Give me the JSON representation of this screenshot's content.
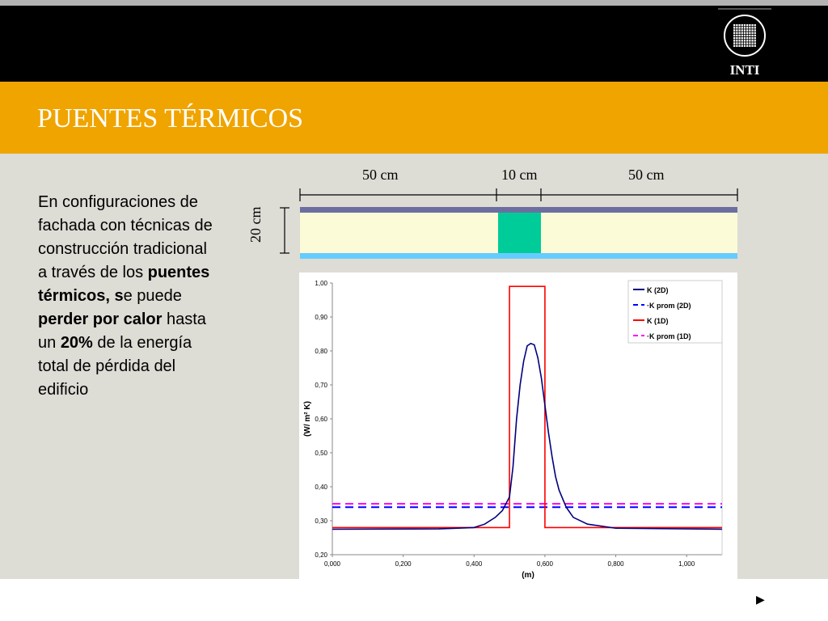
{
  "header": {
    "logo_text": "INTI",
    "title": "PUENTES TÉRMICOS"
  },
  "text": {
    "p1": "En configuraciones de fachada con técnicas de construcción tradicional a través de los ",
    "b1": "puentes térmicos, s",
    "p2": "e puede ",
    "b2": "perder por calor",
    "p3": " hasta un ",
    "b3": "20%",
    "p4": " de la energía total de pérdida del edificio"
  },
  "diagram": {
    "dim_left": "50 cm",
    "dim_mid": "10 cm",
    "dim_right": "50 cm",
    "dim_height": "20 cm",
    "colors": {
      "outer": "#6b6fa0",
      "insulation": "#fbfbd8",
      "bridge": "#00cc99",
      "inner": "#66ccff"
    }
  },
  "chart_data": {
    "type": "line",
    "xlabel": "(m)",
    "ylabel": "(W/ m² K)",
    "xlim": [
      0,
      1.1
    ],
    "ylim": [
      0.2,
      1.0
    ],
    "xticks": [
      "0,000",
      "0,200",
      "0,400",
      "0,600",
      "0,800",
      "1,000"
    ],
    "xtick_values": [
      0,
      0.2,
      0.4,
      0.6,
      0.8,
      1.0
    ],
    "yticks": [
      "0,20",
      "0,30",
      "0,40",
      "0,50",
      "0,60",
      "0,70",
      "0,80",
      "0,90",
      "1,00"
    ],
    "ytick_values": [
      0.2,
      0.3,
      0.4,
      0.5,
      0.6,
      0.7,
      0.8,
      0.9,
      1.0
    ],
    "legend_position": "top-right",
    "series": [
      {
        "name": "K (2D)",
        "color": "#000080",
        "style": "solid",
        "x": [
          0,
          0.3,
          0.4,
          0.43,
          0.46,
          0.48,
          0.5,
          0.51,
          0.52,
          0.53,
          0.54,
          0.55,
          0.56,
          0.57,
          0.58,
          0.59,
          0.6,
          0.61,
          0.62,
          0.63,
          0.64,
          0.66,
          0.68,
          0.72,
          0.8,
          1.1
        ],
        "y": [
          0.275,
          0.276,
          0.28,
          0.29,
          0.31,
          0.33,
          0.37,
          0.46,
          0.6,
          0.7,
          0.77,
          0.815,
          0.822,
          0.818,
          0.78,
          0.72,
          0.64,
          0.56,
          0.49,
          0.43,
          0.39,
          0.34,
          0.31,
          0.29,
          0.278,
          0.275
        ]
      },
      {
        "name": "K prom (2D)",
        "color": "#0000ff",
        "style": "dash",
        "x": [
          0,
          1.1
        ],
        "y": [
          0.34,
          0.34
        ]
      },
      {
        "name": "K (1D)",
        "color": "#ff0000",
        "style": "solid",
        "x": [
          0,
          0.5,
          0.5,
          0.6,
          0.6,
          1.1
        ],
        "y": [
          0.28,
          0.28,
          0.99,
          0.99,
          0.28,
          0.28
        ]
      },
      {
        "name": "K prom (1D)",
        "color": "#ff00ff",
        "style": "dash",
        "x": [
          0,
          1.1
        ],
        "y": [
          0.35,
          0.35
        ]
      }
    ]
  },
  "nav": {
    "next": "▶"
  }
}
